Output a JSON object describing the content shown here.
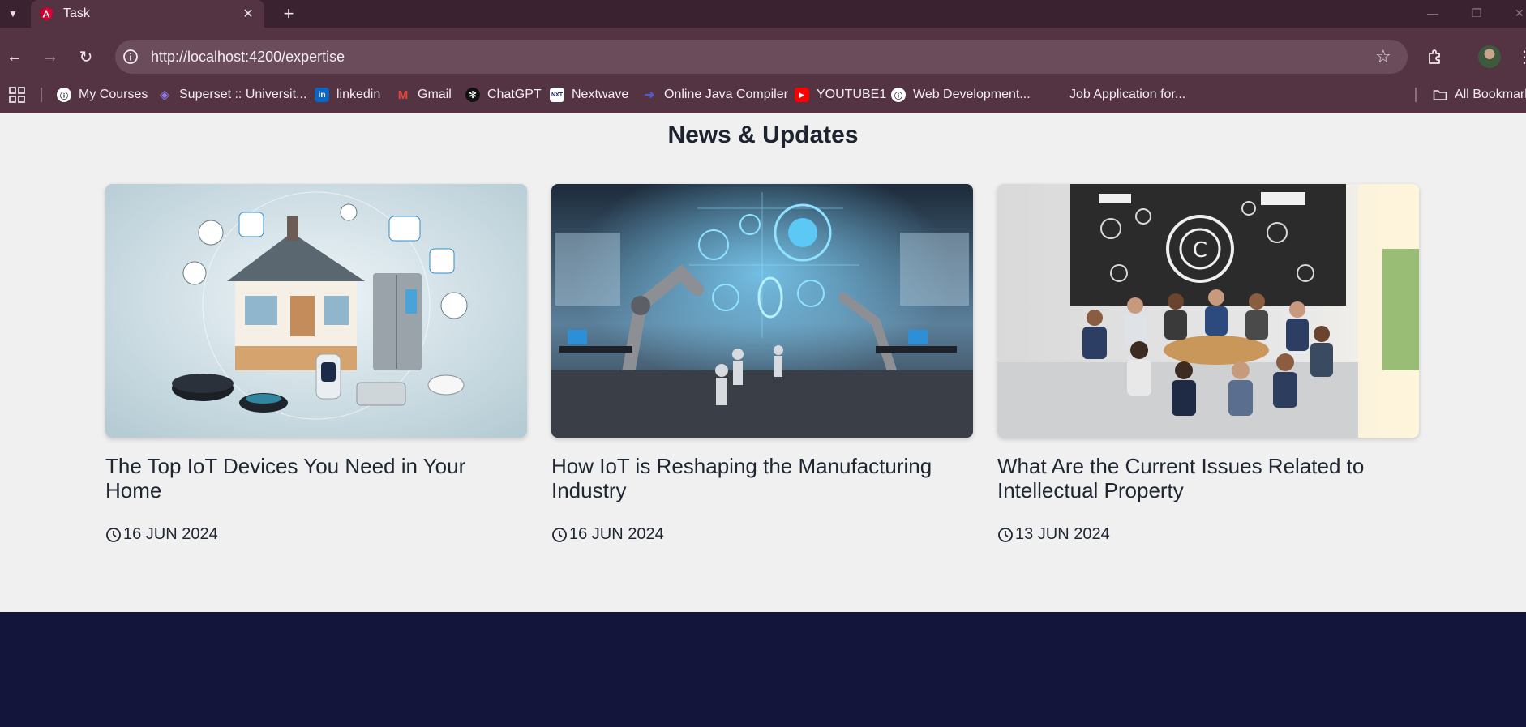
{
  "browser": {
    "tab_title": "Task",
    "url": "http://localhost:4200/expertise",
    "bookmarks": [
      {
        "label": "My Courses",
        "icon": "course-icon",
        "color": "#ffffff"
      },
      {
        "label": "Superset :: Universit...",
        "icon": "superset-icon",
        "color": "#6a5acd"
      },
      {
        "label": "linkedin",
        "icon": "linkedin-icon",
        "color": "#0a66c2"
      },
      {
        "label": "Gmail",
        "icon": "gmail-icon",
        "color": "#ea4335"
      },
      {
        "label": "ChatGPT",
        "icon": "chatgpt-icon",
        "color": "#111111"
      },
      {
        "label": "Nextwave",
        "icon": "nextwave-icon",
        "color": "#ffffff"
      },
      {
        "label": "Online Java Compiler",
        "icon": "compiler-icon",
        "color": "#4f5bd5"
      },
      {
        "label": "YOUTUBE1",
        "icon": "youtube-icon",
        "color": "#ff0000"
      },
      {
        "label": "Web Development...",
        "icon": "course-icon",
        "color": "#ffffff"
      },
      {
        "label": "Job Application for...",
        "icon": "",
        "color": ""
      }
    ],
    "all_bookmarks": "All Bookmarks"
  },
  "page": {
    "section_title": "News & Updates",
    "cards": [
      {
        "title": "The Top IoT Devices You Need in Your Home",
        "date": "16 JUN 2024",
        "image": "smart-home-iot-devices-image"
      },
      {
        "title": "How IoT is Reshaping the Manufacturing Industry",
        "date": "16 JUN 2024",
        "image": "robotic-factory-image"
      },
      {
        "title": "What Are the Current Issues Related to Intellectual Property",
        "date": "13 JUN 2024",
        "image": "copyright-meeting-image"
      }
    ]
  },
  "colors": {
    "tabbar": "#3b2231",
    "toolbar": "#543443",
    "page_bg": "#f0f0f0",
    "footer": "#13163a",
    "text": "#1f2531"
  }
}
